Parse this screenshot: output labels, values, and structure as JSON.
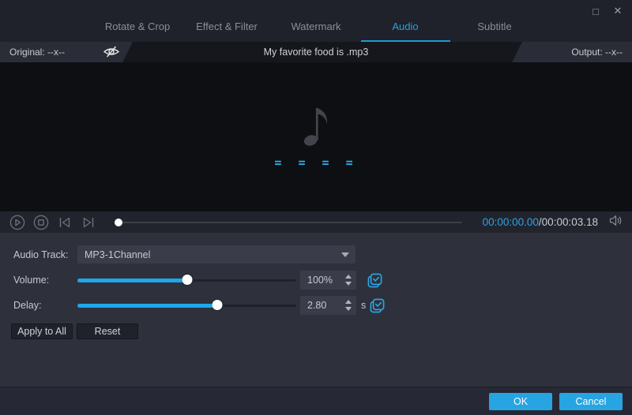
{
  "window": {
    "controls": {
      "maximize": "□",
      "close": "✕"
    }
  },
  "tabs": [
    {
      "label": "Rotate & Crop",
      "active": false
    },
    {
      "label": "Effect & Filter",
      "active": false
    },
    {
      "label": "Watermark",
      "active": false
    },
    {
      "label": "Audio",
      "active": true
    },
    {
      "label": "Subtitle",
      "active": false
    }
  ],
  "info_bar": {
    "original_label": "Original: --x--",
    "title": "My favorite food is .mp3",
    "output_label": "Output: --x--"
  },
  "preview": {
    "dashes": "= = = ="
  },
  "player": {
    "seek_percent": 0,
    "time_current": "00:00:00.00",
    "time_separator": "/",
    "time_total": "00:00:03.18"
  },
  "settings": {
    "audio_track": {
      "label": "Audio Track:",
      "value": "MP3-1Channel"
    },
    "volume": {
      "label": "Volume:",
      "value": "100%",
      "slider_percent": 50
    },
    "delay": {
      "label": "Delay:",
      "value": "2.80",
      "unit": "s",
      "slider_percent": 64
    },
    "apply_all_label": "Apply to All",
    "reset_label": "Reset"
  },
  "footer": {
    "ok_label": "OK",
    "cancel_label": "Cancel"
  },
  "colors": {
    "accent": "#1fa7ea",
    "active_tab": "#2a9fd8"
  }
}
